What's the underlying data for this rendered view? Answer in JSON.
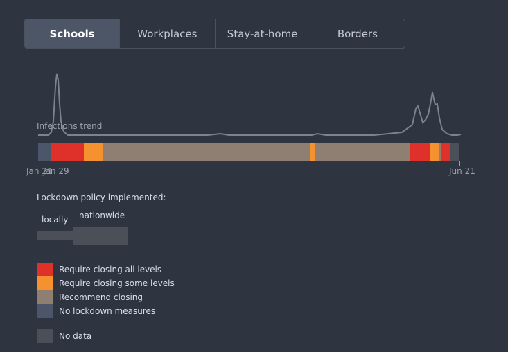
{
  "tabs": [
    {
      "label": "Schools",
      "active": true
    },
    {
      "label": "Workplaces",
      "active": false
    },
    {
      "label": "Stay-at-home",
      "active": false
    },
    {
      "label": "Borders",
      "active": false
    }
  ],
  "trend": {
    "label": "Infections trend",
    "color": "#7b8390"
  },
  "timeline": {
    "start_label": "Jan 21",
    "mid_label": "Jan 29",
    "end_label": "Jun 21",
    "segments": [
      {
        "policy": "none",
        "from": 0.0,
        "to": 0.031
      },
      {
        "policy": "all",
        "from": 0.031,
        "to": 0.108
      },
      {
        "policy": "some",
        "from": 0.108,
        "to": 0.155
      },
      {
        "policy": "recommend",
        "from": 0.155,
        "to": 0.646
      },
      {
        "policy": "some",
        "from": 0.646,
        "to": 0.658
      },
      {
        "policy": "recommend",
        "from": 0.658,
        "to": 0.882
      },
      {
        "policy": "all",
        "from": 0.882,
        "to": 0.931
      },
      {
        "policy": "some",
        "from": 0.931,
        "to": 0.95
      },
      {
        "policy": "recommend",
        "from": 0.95,
        "to": 0.957
      },
      {
        "policy": "all",
        "from": 0.957,
        "to": 0.977
      },
      {
        "policy": "nodata",
        "from": 0.977,
        "to": 1.0
      }
    ]
  },
  "policy": {
    "title": "Lockdown policy implemented:",
    "local_label": "locally",
    "nation_label": "nationwide"
  },
  "colors": {
    "all": "#e0302a",
    "some": "#f5922f",
    "recommend": "#8f7f73",
    "none": "#4c566a",
    "nodata": "#4a4f58"
  },
  "legend": [
    {
      "key": "all",
      "label": "Require closing all levels"
    },
    {
      "key": "some",
      "label": "Require closing some levels"
    },
    {
      "key": "recommend",
      "label": "Recommend closing"
    },
    {
      "key": "none",
      "label": "No lockdown measures"
    }
  ],
  "nodata_label": "No data"
}
